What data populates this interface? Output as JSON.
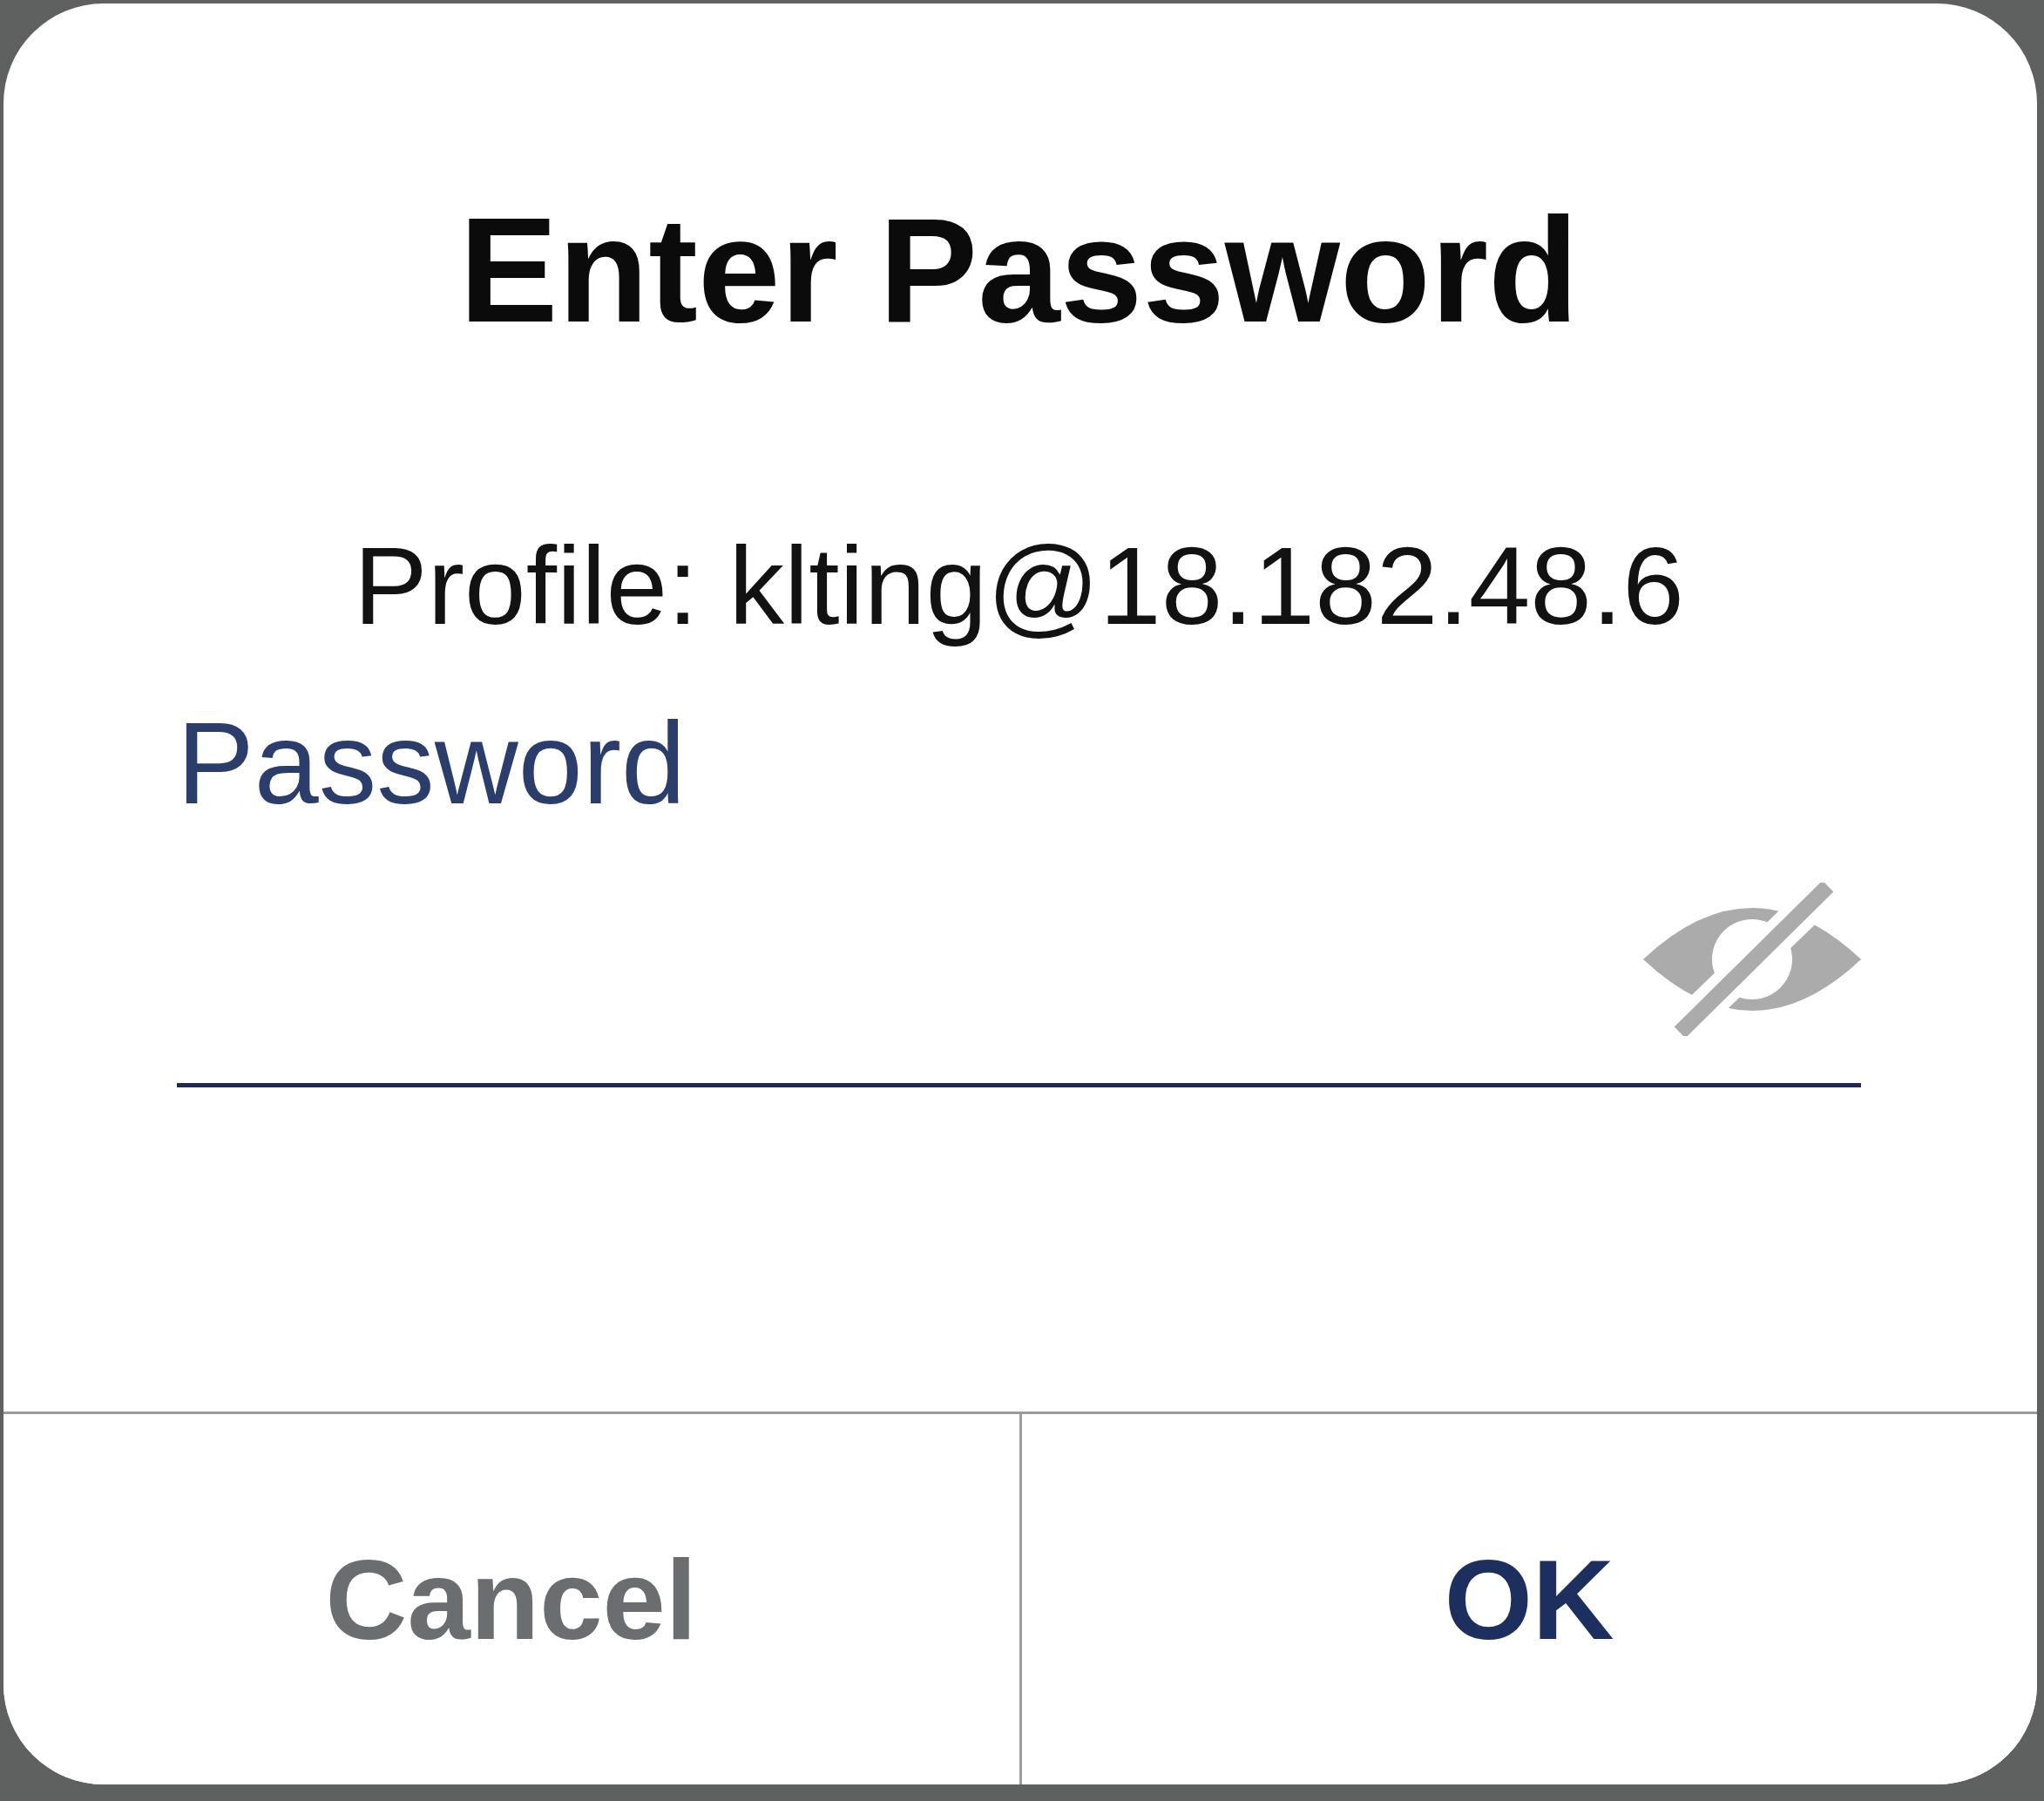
{
  "dialog": {
    "title": "Enter Password",
    "profile": "Profile: klting@18.182.48.6"
  },
  "password_field": {
    "label": "Password"
  },
  "buttons": [
    {
      "label": "Cancel",
      "kind": "cancel"
    },
    {
      "label": "OK",
      "kind": "confirm"
    }
  ]
}
